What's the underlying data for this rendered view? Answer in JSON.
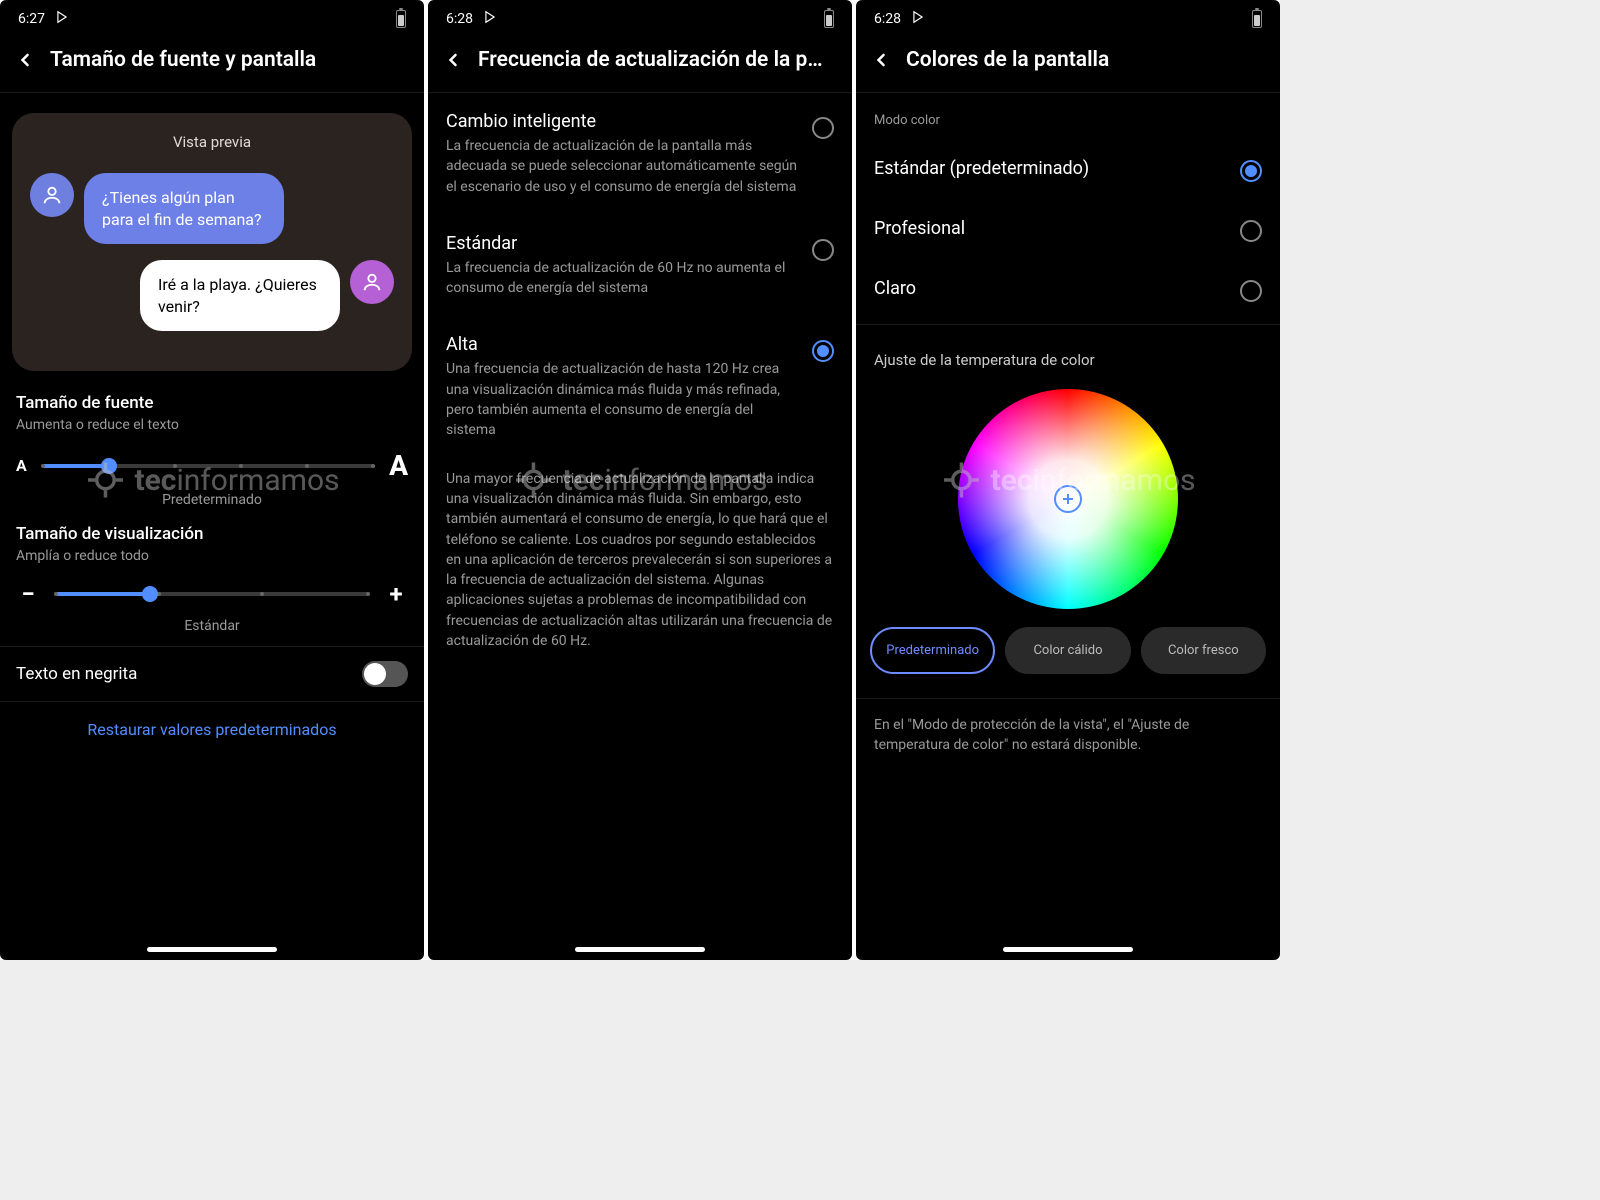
{
  "watermark": {
    "brand_bold": "tec",
    "brand_rest": "informamos"
  },
  "screen1": {
    "time": "6:27",
    "title": "Tamaño de fuente y pantalla",
    "preview_label": "Vista previa",
    "msg1": "¿Tienes algún plan para el fin de semana?",
    "msg2": "Iré a la playa. ¿Quieres venir?",
    "font_size": {
      "title": "Tamaño de fuente",
      "sub": "Aumenta o reduce el texto",
      "small": "A",
      "large": "A",
      "caption": "Predeterminado",
      "value_pct": 20
    },
    "display_size": {
      "title": "Tamaño de visualización",
      "sub": "Amplía o reduce todo",
      "minus": "−",
      "plus": "+",
      "caption": "Estándar",
      "value_pct": 30
    },
    "bold_text": "Texto en negrita",
    "bold_on": false,
    "restore": "Restaurar valores predeterminados"
  },
  "screen2": {
    "time": "6:28",
    "title": "Frecuencia de actualización de la p…",
    "options": [
      {
        "title": "Cambio inteligente",
        "desc": "La frecuencia de actualización de la pantalla más adecuada se puede seleccionar automáticamente según el escenario de uso y el consumo de energía del sistema",
        "selected": false
      },
      {
        "title": "Estándar",
        "desc": "La frecuencia de actualización de 60 Hz no aumenta el consumo de energía del sistema",
        "selected": false
      },
      {
        "title": "Alta",
        "desc": "Una frecuencia de actualización de hasta 120 Hz crea una visualización dinámica más fluida y más refinada, pero también aumenta el consumo de energía del sistema",
        "selected": true
      }
    ],
    "note": "Una mayor frecuencia de actualización de la pantalla indica una visualización dinámica más fluida. Sin embargo, esto también aumentará el consumo de energía, lo que hará que el teléfono se caliente. Los cuadros por segundo establecidos en una aplicación de terceros prevalecerán si son superiores a la frecuencia de actualización del sistema. Algunas aplicaciones sujetas a problemas de incompatibilidad con frecuencias de actualización altas utilizarán una frecuencia de actualización de 60 Hz."
  },
  "screen3": {
    "time": "6:28",
    "title": "Colores de la pantalla",
    "mode_header": "Modo color",
    "modes": [
      {
        "label": "Estándar (predeterminado)",
        "selected": true
      },
      {
        "label": "Profesional",
        "selected": false
      },
      {
        "label": "Claro",
        "selected": false
      }
    ],
    "temp_header": "Ajuste de la temperatura de color",
    "chips": [
      {
        "label": "Predeterminado",
        "selected": true
      },
      {
        "label": "Color cálido",
        "selected": false
      },
      {
        "label": "Color fresco",
        "selected": false
      }
    ],
    "note": "En el \"Modo de protección de la vista\", el \"Ajuste de temperatura de color\" no estará disponible."
  }
}
